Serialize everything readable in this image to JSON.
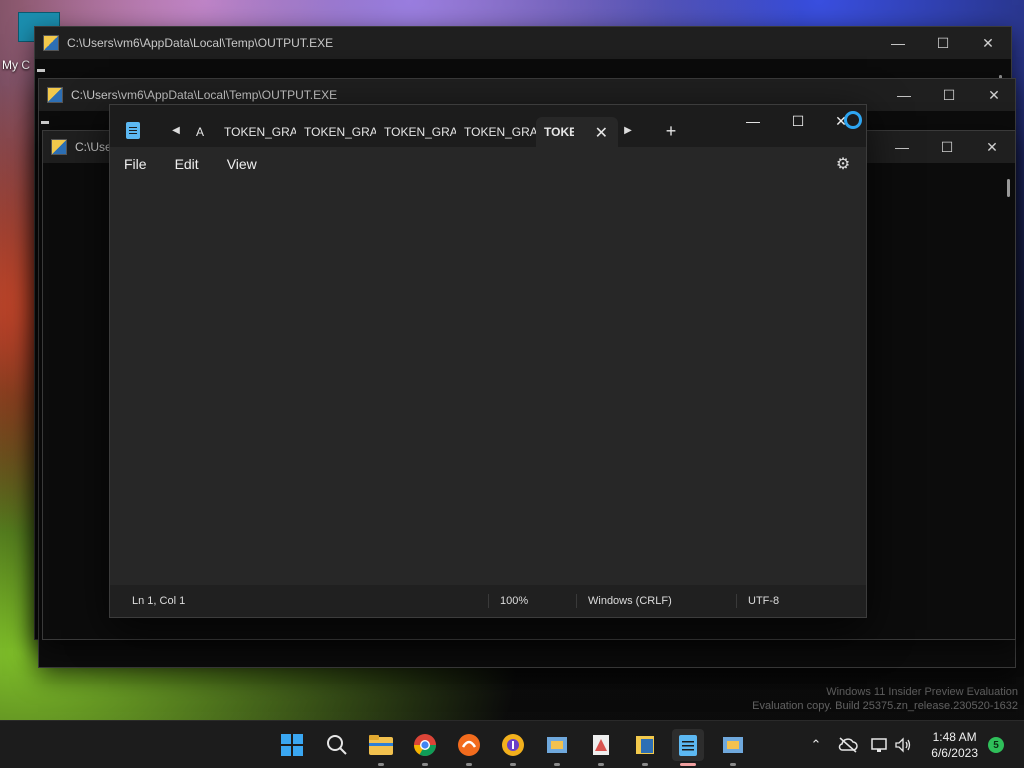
{
  "desktop": {
    "label_partial": "My C",
    "watermark_line1": "Windows 11 Insider Preview Evaluation",
    "watermark_line2": "Evaluation copy. Build 25375.zn_release.230520-1632"
  },
  "console_windows": [
    {
      "title": "C:\\Users\\vm6\\AppData\\Local\\Temp\\OUTPUT.EXE"
    },
    {
      "title": "C:\\Users\\vm6\\AppData\\Local\\Temp\\OUTPUT.EXE"
    },
    {
      "title": "C:\\Users\\vm6"
    }
  ],
  "window_controls": {
    "minimize": "—",
    "maximize": "☐",
    "close": "✕"
  },
  "notepad": {
    "tabs": [
      {
        "label": "A"
      },
      {
        "label": "TOKEN_GRA"
      },
      {
        "label": "TOKEN_GRA"
      },
      {
        "label": "TOKEN_GRA"
      },
      {
        "label": "TOKEN_GRA"
      }
    ],
    "active_tab": {
      "label": "TOKEN",
      "close": "✕"
    },
    "add_tab": "+",
    "scroll_left": "◀",
    "scroll_right": "▶",
    "menu": {
      "file": "File",
      "edit": "Edit",
      "view": "View"
    },
    "settings_glyph": "⚙",
    "status": {
      "position": "Ln 1, Col 1",
      "zoom": "100%",
      "line_ending": "Windows (CRLF)",
      "encoding": "UTF-8"
    }
  },
  "taskbar": {
    "clock_time": "1:48 AM",
    "clock_date": "6/6/2023",
    "notification_count": "5",
    "apps": [
      "start-icon",
      "search-icon",
      "file-explorer-icon",
      "chrome-icon",
      "app-orange-icon",
      "app-yellow-icon",
      "app-icon-1",
      "app-icon-2",
      "app-icon-3",
      "notepad-icon",
      "app-icon-4"
    ]
  },
  "colors": {
    "accent_blue": "#2ea6f2",
    "notif_green": "#2fbf5a"
  }
}
